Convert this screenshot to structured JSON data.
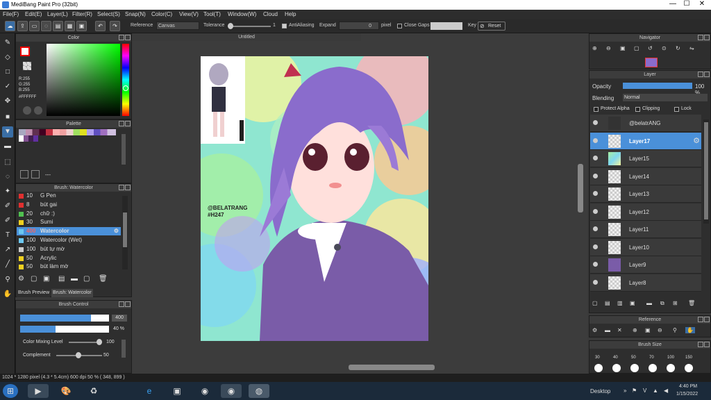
{
  "app": {
    "title": "MediBang Paint Pro (32bit)",
    "min": "—",
    "max": "☐",
    "close": "✕"
  },
  "menu": [
    "File(F)",
    "Edit(E)",
    "Layer(L)",
    "Filter(R)",
    "Select(S)",
    "Snap(N)",
    "Color(C)",
    "View(V)",
    "Tool(T)",
    "Window(W)",
    "Cloud",
    "Help"
  ],
  "toolbar": {
    "reference_label": "Reference",
    "reference_value": "Canvas",
    "tolerance_label": "Tolerance",
    "tolerance_value": "1",
    "antialias_label": "AntiAliasing",
    "expand_label": "Expand",
    "expand_value": "0",
    "expand_unit": "pixel",
    "closegaps_label": "Close Gaps",
    "key_label": "Key",
    "reset_label": "Reset"
  },
  "color_panel": {
    "title": "Color",
    "r": "R:255",
    "g": "G:255",
    "b": "B:255",
    "hex": "#FFFFFF"
  },
  "palette_panel": {
    "title": "Palette",
    "more": "---"
  },
  "brush_panel": {
    "title": "Brush: Watercolor",
    "items": [
      {
        "size": "10",
        "name": "G Pen",
        "color": "#e03030"
      },
      {
        "size": "8",
        "name": "bút gai",
        "color": "#e03030"
      },
      {
        "size": "20",
        "name": "chữ :)",
        "color": "#50c050"
      },
      {
        "size": "30",
        "name": "Sumi",
        "color": "#f0d020"
      },
      {
        "size": "400",
        "name": "Watercolor",
        "color": "#6cc8f0",
        "selected": true
      },
      {
        "size": "100",
        "name": "Watercolor (Wet)",
        "color": "#6cc8f0"
      },
      {
        "size": "100",
        "name": "bút tự mờ",
        "color": "#cccccc"
      },
      {
        "size": "50",
        "name": "Acrylic",
        "color": "#f0d020"
      },
      {
        "size": "50",
        "name": "bút làm mờ",
        "color": "#f0d020"
      }
    ],
    "tabs": [
      "Brush Preview",
      "Brush: Watercolor"
    ]
  },
  "brush_control": {
    "title": "Brush Control",
    "size_value": "400",
    "opacity_value": "40 %",
    "mixing_label": "Color Mixing Level",
    "mixing_value": "100",
    "complement_label": "Complement",
    "complement_value": "50",
    "size_fill": 0.8,
    "opacity_fill": 0.4
  },
  "canvas": {
    "tab_title": "Untitled",
    "watermark": "@BELATRANG",
    "watermark2": "#H247"
  },
  "navigator": {
    "title": "Navigator"
  },
  "layer_panel": {
    "title": "Layer",
    "opacity_label": "Opacity",
    "opacity_value": "100 %",
    "blending_label": "Blending",
    "blending_value": "Normal",
    "protect_alpha": "Protect Alpha",
    "clipping": "Clipping",
    "lock": "Lock",
    "layers": [
      "@belatrANG",
      "Layer17",
      "Layer15",
      "Layer14",
      "Layer13",
      "Layer12",
      "Layer11",
      "Layer10",
      "Layer9",
      "Layer8"
    ],
    "selected": "Layer17"
  },
  "reference_panel": {
    "title": "Reference"
  },
  "brushsize_panel": {
    "title": "Brush Size",
    "sizes": [
      "30",
      "40",
      "50",
      "70",
      "100",
      "150"
    ]
  },
  "status": {
    "text": "1024 * 1280 pixel   (4.3 * 5.4cm)  600 dpi  50 %  ( 348, 899 )"
  },
  "taskbar": {
    "desktop": "Desktop",
    "time": "4:40 PM",
    "date": "1/15/2022"
  }
}
